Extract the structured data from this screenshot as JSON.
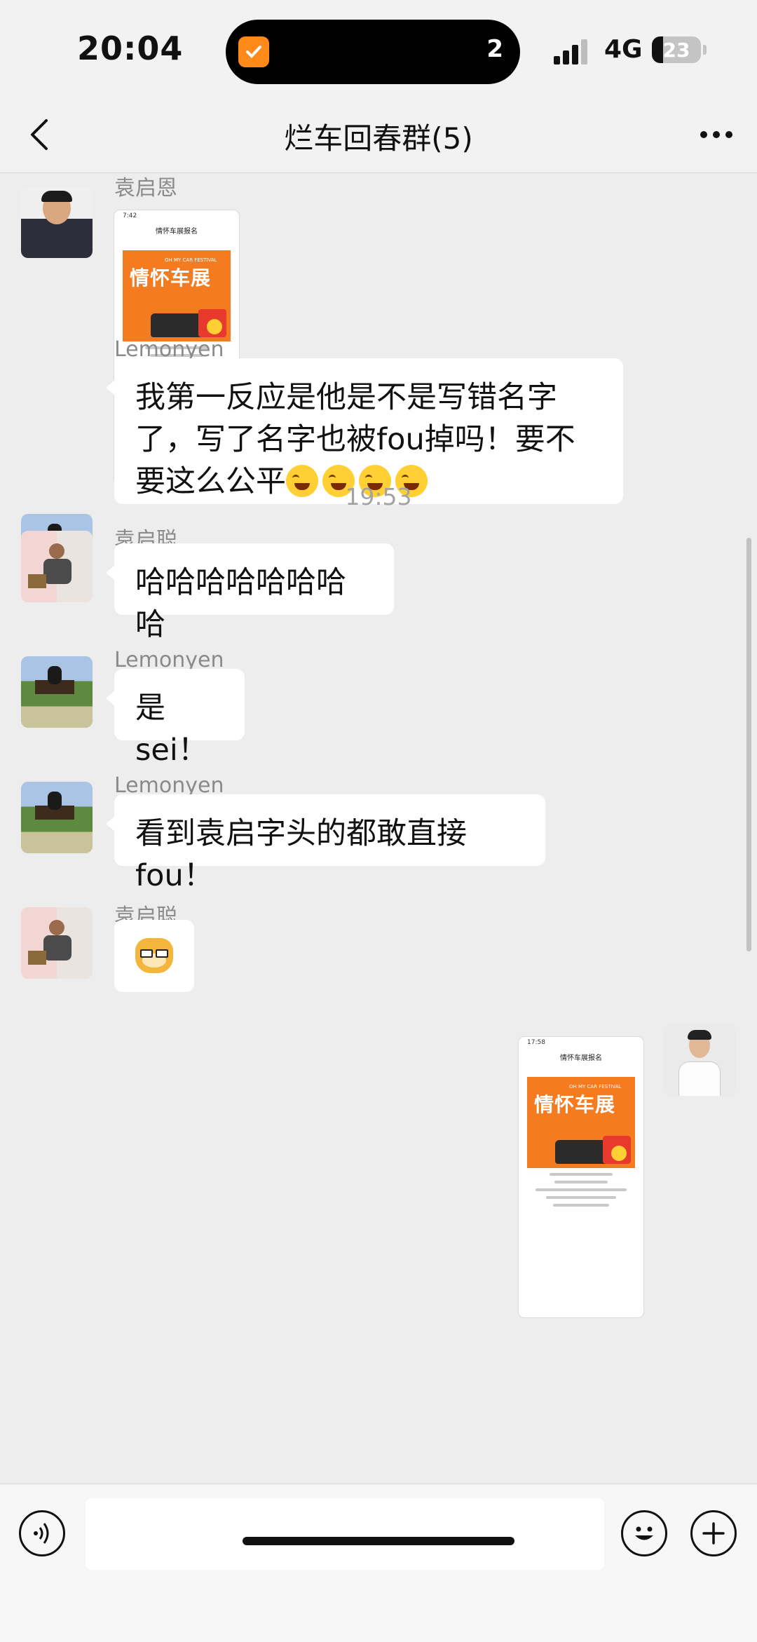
{
  "status_bar": {
    "time": "20:04",
    "island_count": "2",
    "network": "4G",
    "battery": "23",
    "battery_level_percent": 23
  },
  "nav": {
    "title": "烂车回春群(5)"
  },
  "messages": [
    {
      "sender": "袁启恩",
      "type": "image",
      "image_title": "情怀车展报名",
      "poster_text": "情怀车展",
      "poster_tag": "OH MY CAR FESTIVAL",
      "shot_time": "7:42"
    },
    {
      "sender": "Lemonyen",
      "type": "text",
      "text": "我第一反应是他是不是写错名字了，写了名字也被fou掉吗！要不要这么公平"
    },
    {
      "type": "time",
      "text": "19:53"
    },
    {
      "sender": "袁启聪",
      "type": "text",
      "text": "哈哈哈哈哈哈哈哈"
    },
    {
      "sender": "Lemonyen",
      "type": "text",
      "text": "是sei！"
    },
    {
      "sender": "Lemonyen",
      "type": "text",
      "text": "看到袁启字头的都敢直接fou！"
    },
    {
      "sender": "袁启聪",
      "type": "sticker",
      "icon": "doge-icon"
    },
    {
      "sender": "self",
      "type": "image",
      "image_title": "情怀车展报名",
      "poster_text": "情怀车展",
      "poster_tag": "OH MY CAR FESTIVAL",
      "shot_time": "17:58"
    }
  ],
  "input_bar": {
    "voice_icon": "voice-icon",
    "emoji_icon": "emoji-icon",
    "plus_icon": "plus-icon",
    "message_value": ""
  },
  "colors": {
    "background": "#ededed",
    "bubble": "#ffffff",
    "accent": "#f47b20"
  }
}
